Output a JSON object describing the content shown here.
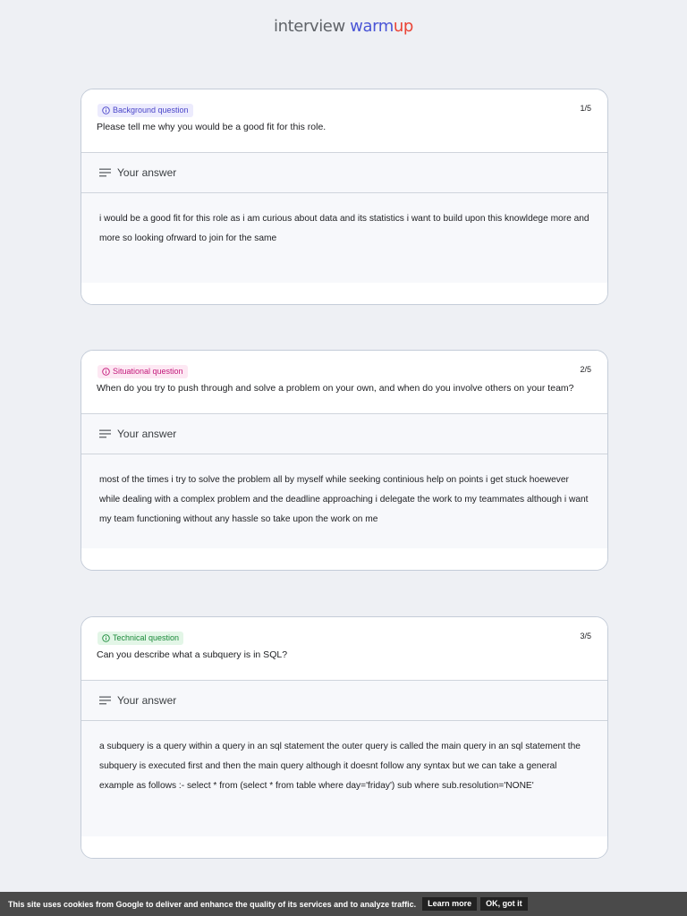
{
  "brand": {
    "part1": "interview ",
    "part2": "warm",
    "part3": "up"
  },
  "answer_label": "Your answer",
  "cards": [
    {
      "badge": "Background question",
      "counter": "1/5",
      "question": "Please tell me why you would be a good fit for this role.",
      "answer": "i would be a good fit for this role as i am curious about data and its statistics i want to build upon this knowldege more and more so looking ofrward to join for the same"
    },
    {
      "badge": "Situational question",
      "counter": "2/5",
      "question": "When do you try to push through and solve a problem on your own, and when do you involve others on your team?",
      "answer": "most of the times i try to solve the problem all by myself while seeking continious help on points i get stuck hoewever while dealing with a complex problem and the deadline approaching i delegate the work to my teammates although i want my team functioning without any hassle so take upon the work on me"
    },
    {
      "badge": "Technical question",
      "counter": "3/5",
      "question": "Can you describe what a subquery is in SQL?",
      "answer": "a subquery is a query within a query in an sql statement the outer query is called the main query in an sql statement the subquery is executed first and then the main query although it doesnt follow any syntax but we can take a general example as follows :- select * from (select * from table where day='friday') sub where sub.resolution='NONE'"
    }
  ],
  "cookie": {
    "text": "This site uses cookies from Google to deliver and enhance the quality of its services and to analyze traffic.",
    "learn_more": "Learn more",
    "ok": "OK, got it"
  },
  "colors": {
    "badge_background": "#4a46c9",
    "badge_situational": "#c2187a",
    "badge_technical": "#1b8a3a",
    "brand_blue": "#4a55d6",
    "brand_red": "#ea4335"
  },
  "icons": [
    "info-icon",
    "notes-lines-icon"
  ]
}
